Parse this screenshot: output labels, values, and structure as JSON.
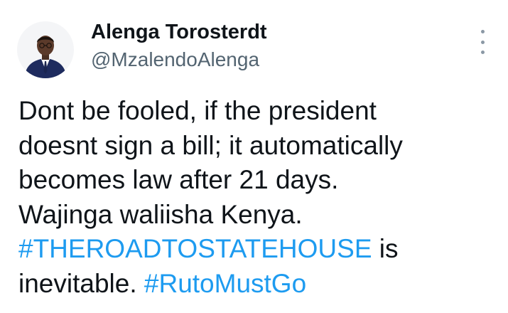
{
  "author": {
    "display_name": "Alenga Torosterdt",
    "handle": "@MzalendoAlenga"
  },
  "icons": {
    "avatar": "profile-photo-man-in-suit",
    "more": "vertical-ellipsis-icon"
  },
  "tweet": {
    "line1": "Dont be fooled, if the president",
    "line2": "doesnt sign a bill; it automatically",
    "line3": "becomes law after 21 days.",
    "line4": "Wajinga waliisha Kenya.",
    "hashtag1": "#THEROADTOSTATEHOUSE",
    "after_hashtag1": " is",
    "line6_prefix": "inevitable. ",
    "hashtag2": "#RutoMustGo"
  },
  "colors": {
    "text": "#0f1419",
    "secondary_text": "#536471",
    "link": "#1d9bf0",
    "background": "#ffffff"
  }
}
